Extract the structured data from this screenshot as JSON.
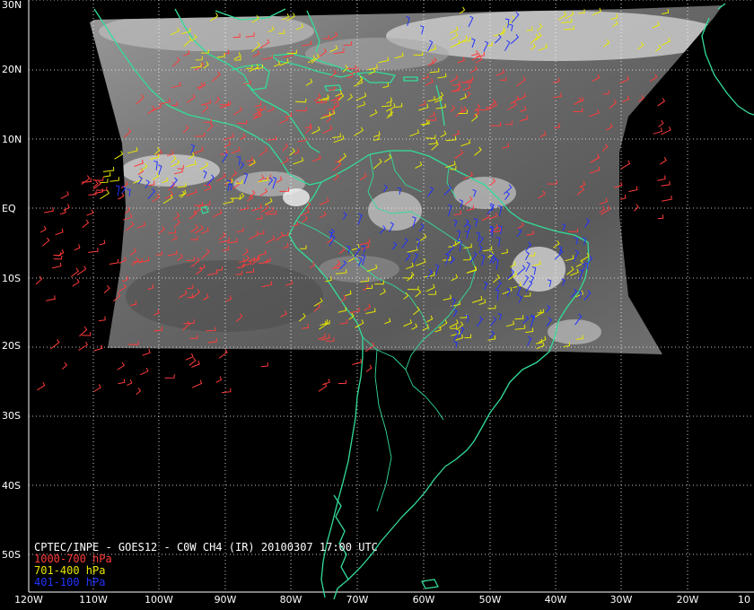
{
  "title": "CPTEC/INPE - GOES12 - C0W CH4 (IR) 20100307 17:00 UTC",
  "legend": [
    {
      "label": "1000-700 hPa",
      "color": "#ff3b3b"
    },
    {
      "label": "701-400 hPa",
      "color": "#e8e800"
    },
    {
      "label": "401-100 hPa",
      "color": "#2233ff"
    }
  ],
  "lat_labels": [
    "30N",
    "20N",
    "10N",
    "EQ",
    "10S",
    "20S",
    "30S",
    "40S",
    "50S"
  ],
  "lon_labels": [
    "120W",
    "110W",
    "100W",
    "90W",
    "80W",
    "70W",
    "60W",
    "50W",
    "40W",
    "30W",
    "20W",
    "10"
  ],
  "colors": {
    "background": "#000000",
    "coastline": "#33dd99",
    "grid": "#ffffff"
  }
}
